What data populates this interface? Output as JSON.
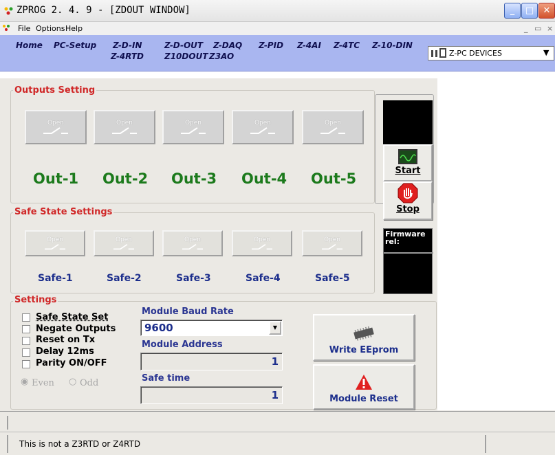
{
  "window": {
    "title": "ZPROG  2. 4. 9 - [ZDOUT  WINDOW]",
    "minimize": "_",
    "maximize": "□",
    "close": "✕"
  },
  "menu": {
    "file": "File",
    "options": "Options",
    "help": "Help",
    "child_min": "_",
    "child_restore": "▭",
    "child_close": "×"
  },
  "nav": {
    "home": "Home",
    "pc_setup": "PC-Setup",
    "zdin": "Z-D-IN",
    "z4rtd": "Z-4RTD",
    "zdout": "Z-D-OUT",
    "z10dout": "Z10DOUT",
    "zdaq": "Z-DAQ",
    "z3ao": "Z3AO",
    "zpid": "Z-PID",
    "z4ai": "Z-4AI",
    "z4tc": "Z-4TC",
    "z10din": "Z-10-DIN",
    "device_select": "Z-PC DEVICES"
  },
  "outputs": {
    "title": "Outputs Setting",
    "relay_state": "Open",
    "labels": [
      "Out-1",
      "Out-2",
      "Out-3",
      "Out-4",
      "Out-5"
    ]
  },
  "safe_state": {
    "title": "Safe State Settings",
    "relay_state": "Open",
    "labels": [
      "Safe-1",
      "Safe-2",
      "Safe-3",
      "Safe-4",
      "Safe-5"
    ]
  },
  "controls": {
    "start": "Start",
    "stop": "Stop",
    "firmware": "Firmware rel:"
  },
  "settings": {
    "title": "Settings",
    "checkboxes": [
      "Safe State Set",
      "Negate Outputs",
      "Reset on Tx",
      "Delay 12ms",
      "Parity ON/OFF"
    ],
    "parity_even": "Even",
    "parity_odd": "Odd",
    "baud_label": "Module Baud Rate",
    "baud_value": "9600",
    "address_label": "Module Address",
    "address_value": "1",
    "safe_time_label": "Safe time",
    "safe_time_value": "1",
    "write_eeprom": "Write EEprom",
    "module_reset": "Module Reset"
  },
  "status": {
    "message": "This is not a Z3RTD or Z4RTD"
  },
  "colors": {
    "nav_bg": "#a9b6f0",
    "group_title": "#d02828",
    "output_label": "#1c7a1c",
    "safe_label": "#1c2e8c"
  }
}
